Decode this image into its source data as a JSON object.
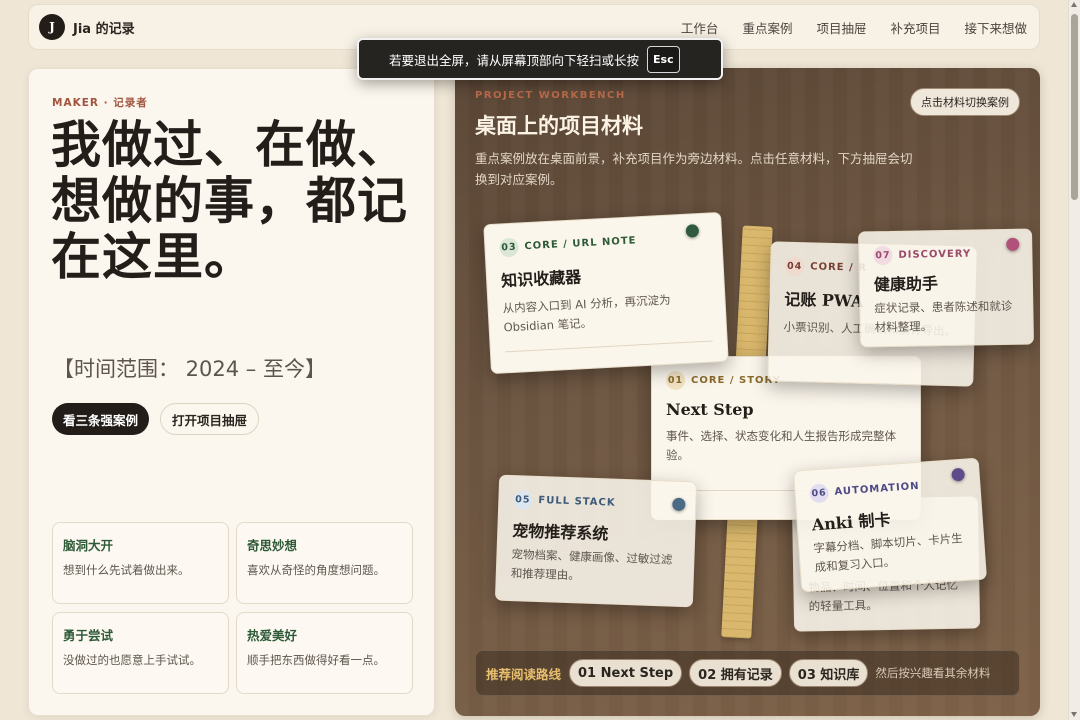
{
  "nav": {
    "logo_letter": "J",
    "brand": "Jia 的记录",
    "links": [
      "工作台",
      "重点案例",
      "项目抽屉",
      "补充项目",
      "接下来想做"
    ]
  },
  "toast": {
    "message": "若要退出全屏，请从屏幕顶部向下轻扫或长按",
    "key": "Esc"
  },
  "hero": {
    "eyebrow": "MAKER · 记录者",
    "title": "我做过、在做、想做的事，都记在这里。",
    "range": "【时间范围：  2024 – 至今】",
    "primary_button": "看三条强案例",
    "secondary_button": "打开项目抽屉"
  },
  "traits": [
    {
      "title": "脑洞大开",
      "desc": "想到什么先试着做出来。"
    },
    {
      "title": "奇思妙想",
      "desc": "喜欢从奇怪的角度想问题。"
    },
    {
      "title": "勇于尝试",
      "desc": "没做过的也愿意上手试试。"
    },
    {
      "title": "热爱美好",
      "desc": "顺手把东西做得好看一点。"
    }
  ],
  "workbench": {
    "eyebrow": "PROJECT WORKBENCH",
    "title": "桌面上的项目材料",
    "desc": "重点案例放在桌面前景，补充项目作为旁边材料。点击任意材料，下方抽屉会切换到对应案例。",
    "switch_button": "点击材料切换案例"
  },
  "cards": {
    "c01": {
      "num": "01",
      "tag": "CORE / STORY",
      "title": "Next Step",
      "desc": "事件、选择、状态变化和人生报告形成完整体验。"
    },
    "c03": {
      "num": "03",
      "tag": "CORE / URL NOTE",
      "title": "知识收藏器",
      "desc": "从内容入口到 AI 分析，再沉淀为 Obsidian 笔记。"
    },
    "c04": {
      "num": "04",
      "tag": "CORE / R",
      "title": "记账 PWA",
      "desc": "小票识别、人工确认和统计导出。"
    },
    "c07": {
      "num": "07",
      "tag": "DISCOVERY",
      "title": "健康助手",
      "desc": "症状记录、患者陈述和就诊材料整理。"
    },
    "c05": {
      "num": "05",
      "tag": "FULL STACK",
      "title": "宠物推荐系统",
      "desc": "宠物档案、健康画像、过敏过滤和推荐理由。"
    },
    "c06": {
      "num": "06",
      "tag": "AUTOMATION",
      "title": "Anki 制卡",
      "desc": "字幕分档、脚本切片、卡片生成和复习入口。"
    },
    "c02_partial": "物品、时间、位置和个人记忆的轻量工具。"
  },
  "route": {
    "label": "推荐阅读路线",
    "steps": [
      "01 Next Step",
      "02 拥有记录",
      "03 知识库"
    ],
    "tail": "然后按兴趣看其余材料"
  },
  "colors": {
    "accent_green": "#2f5a38",
    "accent_rust": "#a2543f",
    "dark": "#221d19",
    "route_gold": "#e7bf6e"
  }
}
